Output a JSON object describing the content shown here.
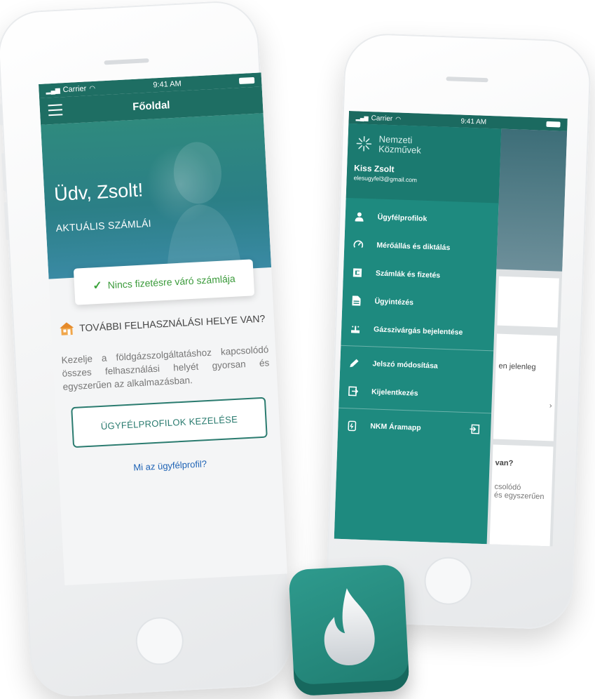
{
  "left_phone": {
    "status": {
      "carrier": "Carrier",
      "time": "9:41 AM"
    },
    "header": {
      "title": "Főoldal"
    },
    "hero": {
      "greeting": "Üdv, Zsolt!",
      "subtitle": "AKTUÁLIS SZÁMLÁI"
    },
    "bill_card": {
      "text": "Nincs fizetésre váró számlája"
    },
    "more_places": {
      "title": "TOVÁBBI FELHASZNÁLÁSI HELYE VAN?",
      "description": "Kezelje a földgázszolgáltatáshoz kapcsolódó összes felhasználási helyét gyorsan és egyszerűen az alkalmazásban.",
      "button_label": "ÜGYFÉLPROFILOK KEZELÉSE",
      "link_label": "Mi az ügyfélprofil?"
    }
  },
  "right_phone": {
    "status": {
      "carrier": "Carrier",
      "time": "9:41 AM"
    },
    "drawer": {
      "brand_line1": "Nemzeti",
      "brand_line2": "Közművek",
      "user_name": "Kiss Zsolt",
      "user_email": "elesugyfel3@gmail.com",
      "items": [
        {
          "label": "Ügyfélprofilok",
          "icon": "person-icon"
        },
        {
          "label": "Mérőállás és diktálás",
          "icon": "gauge-icon"
        },
        {
          "label": "Számlák és fizetés",
          "icon": "invoice-icon"
        },
        {
          "label": "Ügyintézés",
          "icon": "document-icon"
        },
        {
          "label": "Gázszivárgás bejelentése",
          "icon": "gas-leak-icon"
        },
        {
          "label": "Jelszó módosítása",
          "icon": "pencil-icon"
        },
        {
          "label": "Kijelentkezés",
          "icon": "logout-icon"
        },
        {
          "label": "NKM Áramapp",
          "icon": "phone-app-icon"
        }
      ]
    },
    "background_fragments": {
      "text1": "en jelenleg",
      "text2": "van?",
      "text3": "csolódó",
      "text4": "és egyszerűen"
    }
  },
  "colors": {
    "primary": "#1e8a7f",
    "dark_primary": "#1b6a60",
    "link": "#1e63b5",
    "success": "#3a9a3a"
  }
}
